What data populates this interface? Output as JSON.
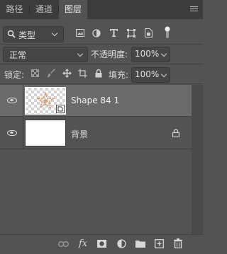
{
  "tabs": [
    {
      "label": "路径",
      "active": false
    },
    {
      "label": "通道",
      "active": false
    },
    {
      "label": "图层",
      "active": true
    }
  ],
  "filter": {
    "kind_label": "类型",
    "icons": [
      "pixel-filter-icon",
      "adjustment-filter-icon",
      "type-filter-icon",
      "shape-filter-icon",
      "smart-object-filter-icon",
      "filter-toggle-icon"
    ]
  },
  "blend": {
    "mode": "正常",
    "opacity_label": "不透明度:",
    "opacity_value": "100%"
  },
  "lock": {
    "label": "锁定:",
    "fill_label": "填充:",
    "fill_value": "100%"
  },
  "layers": [
    {
      "name": "Shape 84 1",
      "visible": true,
      "selected": true,
      "type": "smart-object"
    },
    {
      "name": "背景",
      "visible": true,
      "selected": false,
      "locked": true
    }
  ],
  "colors": {
    "panel_bg": "#535353",
    "selected_layer": "#6b6b6b",
    "shape_accent": "#d7874e"
  },
  "bottom_icons": [
    "link-layers-icon",
    "fx-icon",
    "add-mask-icon",
    "adjustment-layer-icon",
    "new-group-icon",
    "new-layer-icon",
    "delete-layer-icon"
  ],
  "fx_label": "fx"
}
